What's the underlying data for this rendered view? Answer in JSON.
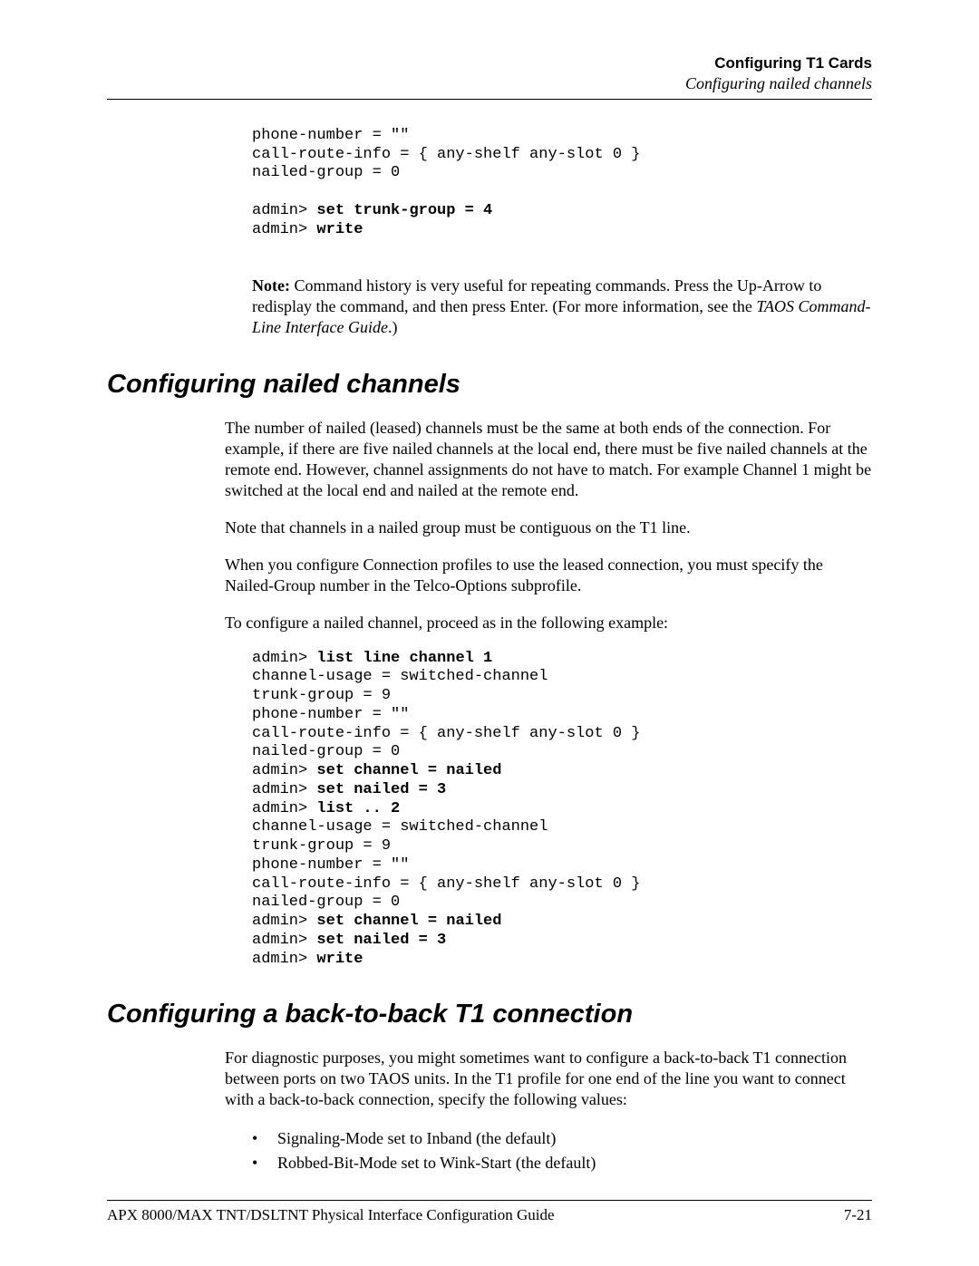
{
  "header": {
    "title_bold": "Configuring T1 Cards",
    "title_italic": "Configuring nailed channels"
  },
  "code1": {
    "l1": "phone-number = \"\"",
    "l2": "call-route-info = { any-shelf any-slot 0 }",
    "l3": "nailed-group = 0",
    "l5a": "admin> ",
    "l5b": "set trunk-group = 4",
    "l6a": "admin> ",
    "l6b": "write"
  },
  "note": {
    "prefix": "Note:",
    "body": "  Command history is very useful for repeating commands. Press the Up-Arrow to redisplay the command, and then press Enter. (For more information, see the ",
    "italic": "TAOS Command-Line Interface Guide",
    "suffix": ".)"
  },
  "sec1": {
    "heading": "Configuring nailed channels",
    "p1": "The number of nailed (leased) channels must be the same at both ends of the connection. For example, if there are five nailed channels at the local end, there must be five nailed channels at the remote end. However, channel assignments do not have to match. For example Channel 1 might be switched at the local end and nailed at the remote end.",
    "p2": "Note that channels in a nailed group must be contiguous on the T1 line.",
    "p3": "When you configure Connection profiles to use the leased connection, you must specify the Nailed-Group number in the Telco-Options subprofile.",
    "p4": "To configure a nailed channel, proceed as in the following example:"
  },
  "code2": {
    "l1a": "admin> ",
    "l1b": "list line channel 1",
    "l2": "channel-usage = switched-channel",
    "l3": "trunk-group = 9",
    "l4": "phone-number = \"\"",
    "l5": "call-route-info = { any-shelf any-slot 0 }",
    "l6": "nailed-group = 0",
    "l7a": "admin> ",
    "l7b": "set channel = nailed",
    "l8a": "admin> ",
    "l8b": "set nailed = 3",
    "l9a": "admin> ",
    "l9b": "list .. 2",
    "l10": "channel-usage = switched-channel",
    "l11": "trunk-group = 9",
    "l12": "phone-number = \"\"",
    "l13": "call-route-info = { any-shelf any-slot 0 }",
    "l14": "nailed-group = 0",
    "l15a": "admin> ",
    "l15b": "set channel = nailed",
    "l16a": "admin> ",
    "l16b": "set nailed = 3",
    "l17a": "admin> ",
    "l17b": "write"
  },
  "sec2": {
    "heading": "Configuring a back-to-back T1 connection",
    "p1": "For diagnostic purposes, you might sometimes want to configure a back-to-back T1 connection between ports on two TAOS units. In the T1 profile for one end of the line you want to connect with a back-to-back connection, specify the following values:",
    "b1": "Signaling-Mode set to Inband (the default)",
    "b2": "Robbed-Bit-Mode set to Wink-Start (the default)"
  },
  "footer": {
    "left": "APX 8000/MAX TNT/DSLTNT Physical Interface Configuration Guide",
    "right": "7-21"
  }
}
